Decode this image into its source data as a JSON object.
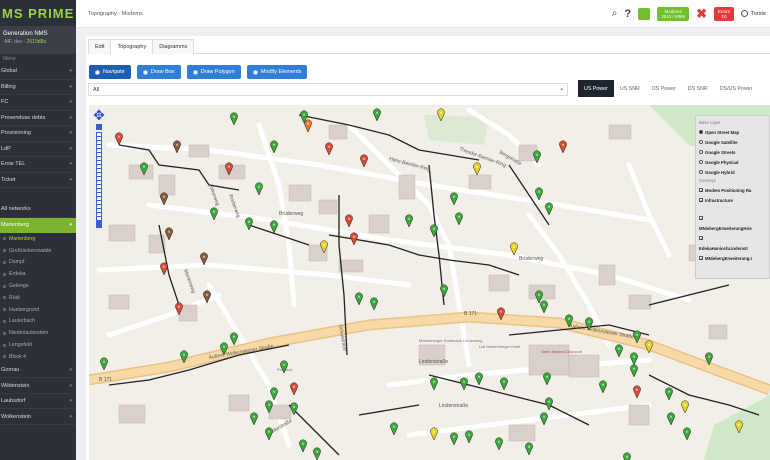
{
  "brand": "MS PRIME",
  "system": {
    "title": "Generation NMS",
    "sub_prefix": "-MF, dev - ",
    "sub_highlight": "2519d8a"
  },
  "sidebar": {
    "menu_heading": "Menu",
    "items": [
      {
        "label": "Global"
      },
      {
        "label": "Billing"
      },
      {
        "label": "FC"
      },
      {
        "label": "Provenduse debts"
      },
      {
        "label": "Provisioning"
      },
      {
        "label": "LdP"
      },
      {
        "label": "Ernie TEL"
      },
      {
        "label": "Ticket"
      }
    ],
    "networks_label": "All networks",
    "active_item": "Marienberg",
    "sub_items": [
      "Marienberg",
      "Großrückerswalde",
      "Dampf",
      "Erdeka",
      "Gelenge",
      "Rüdi",
      "Huebergrund",
      "Lauterbach",
      "Niederlauterstein",
      "Lengefeld",
      "Block 4"
    ],
    "bottom_items": [
      {
        "label": "Gornau"
      },
      {
        "label": "Wildenstein"
      },
      {
        "label": "Laubsdorf"
      },
      {
        "label": "Wolkenstein"
      }
    ]
  },
  "topbar": {
    "breadcrumb": "Topography · Modems",
    "modems_badge_line1": "Modems",
    "modems_badge_line2": "3513 / 6865",
    "errors_badge_line1": "Errors",
    "errors_badge_line2": "10",
    "user_name": "Torste"
  },
  "tabs": [
    "Edit",
    "Topography",
    "Diagramms"
  ],
  "active_tab": "Topography",
  "map_modes": [
    "Navigate",
    "Draw Box",
    "Draw Polygon",
    "Modify Elements"
  ],
  "filter": {
    "value": "All"
  },
  "data_tabs": [
    "US Power",
    "US SNR",
    "DS Power",
    "DS SNR",
    "DS/US Power"
  ],
  "active_data_tab": "US Power",
  "layers": {
    "base_heading": "Base Layer",
    "base": [
      "Open Street Map",
      "Google Satellite",
      "Google Streets",
      "Google Physical",
      "Google Hybrid"
    ],
    "base_selected": "Open Street Map",
    "overlay_heading": "Overlays",
    "overlays": [
      "Modem Positioning Ra",
      "Infrastructure",
      "MNiebergErweiterungHire",
      "EdekaHaniochLindenstr",
      "MNiebergErweiterung.I"
    ]
  },
  "map_labels": [
    "B 171",
    "B 171",
    "Äußere Wolkensteiner Straße",
    "Äußere Wolkensteiner Straße",
    "Brüderweg",
    "Brüderweg",
    "Lindenstraße",
    "Lindenstraße",
    "Hans-Beimler-Ring",
    "Theodor-Beimler-Ring",
    "Schulstraße",
    "Seilerstraße",
    "Ettkerweg",
    "Mertenweg",
    "Rorberweg",
    "Bergstraße",
    "Marienberger Ärztehaus Lindenweg",
    "Lidl Marienberger Kraft",
    "Netto Marken-Discount",
    "Postfach"
  ],
  "colors": {
    "accent": "#7cb32f",
    "primary": "#2f7fd8",
    "danger": "#e23b3b",
    "pin_green": "#3aa83a",
    "pin_red": "#d94a3a",
    "pin_yellow": "#e8d32a",
    "pin_brown": "#8a5a3a",
    "pin_orange": "#e07a2a"
  }
}
